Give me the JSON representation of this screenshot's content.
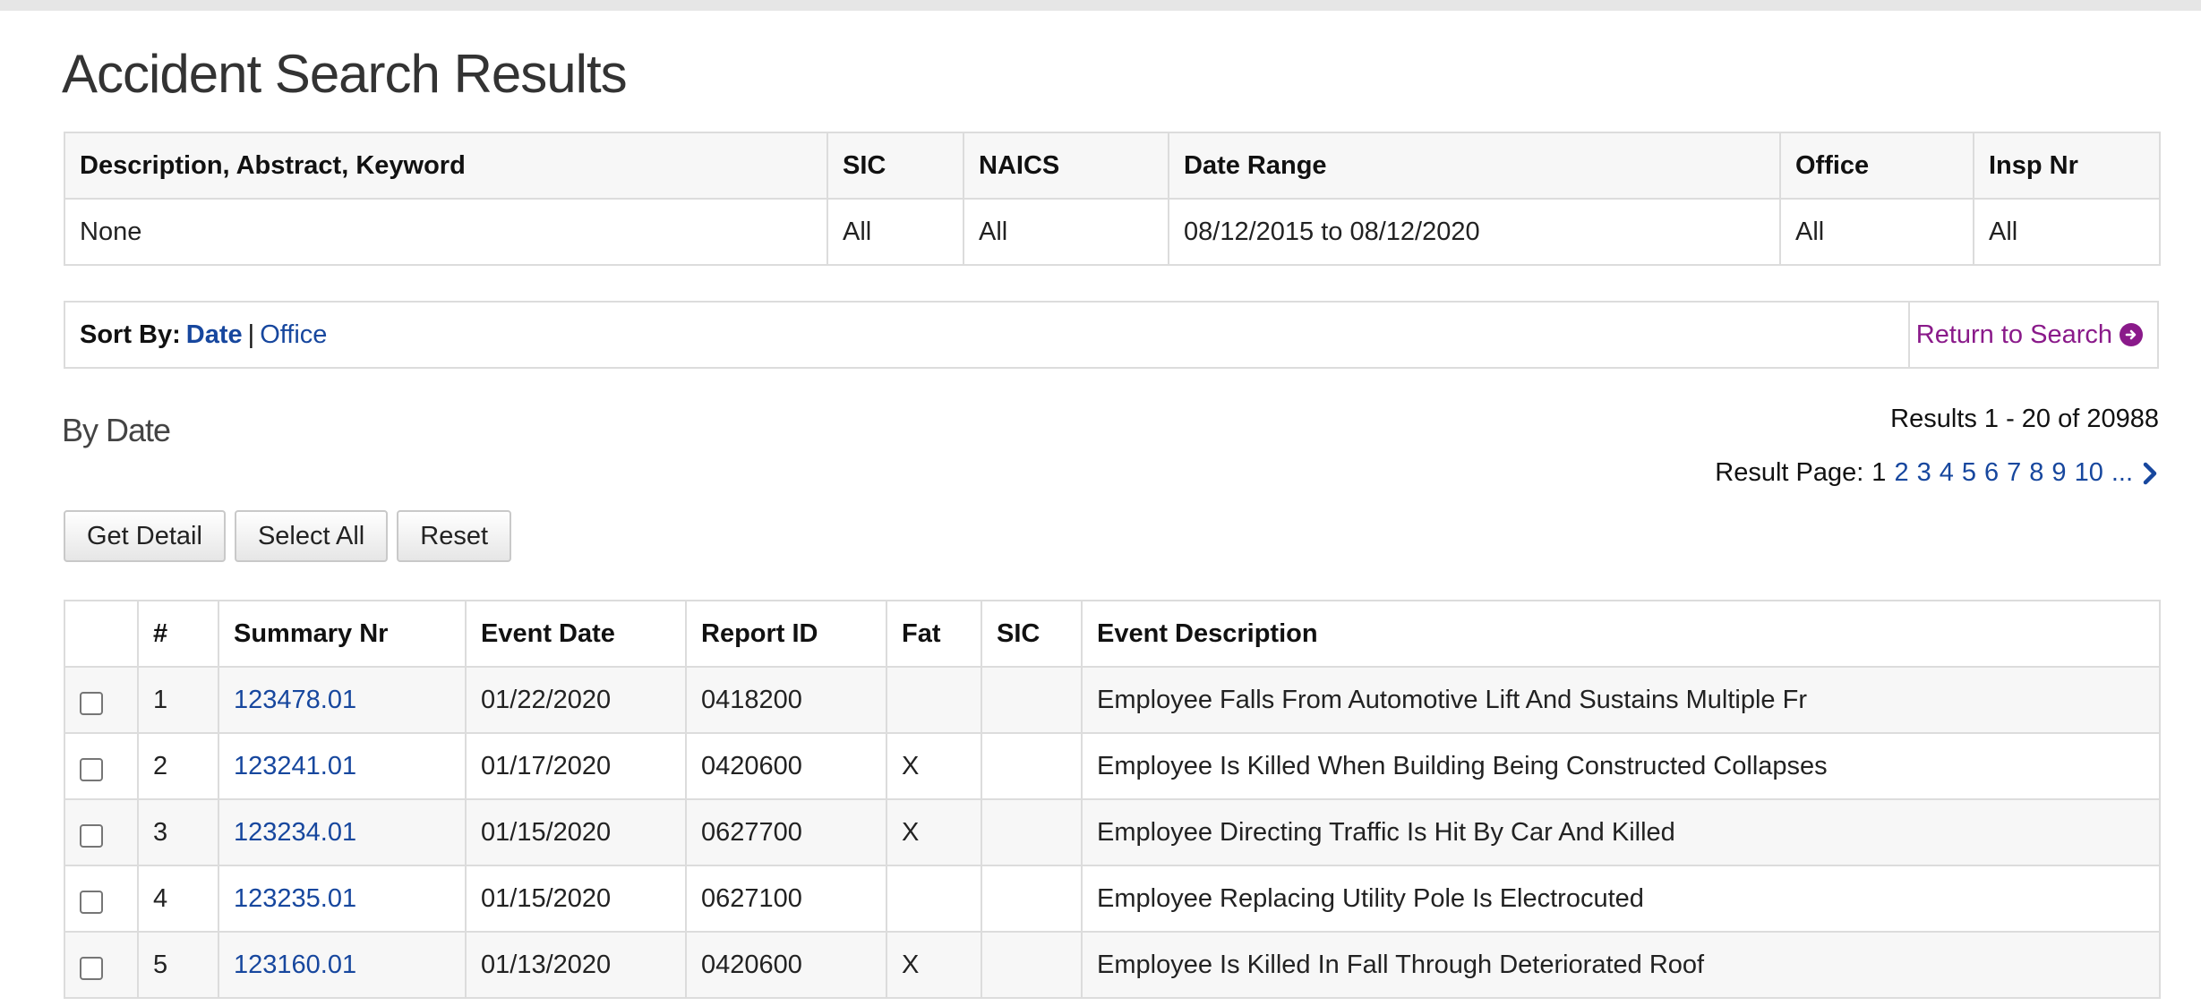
{
  "page": {
    "title": "Accident Search Results"
  },
  "criteria": {
    "headers": [
      "Description, Abstract, Keyword",
      "SIC",
      "NAICS",
      "Date Range",
      "Office",
      "Insp Nr"
    ],
    "values": [
      "None",
      "All",
      "All",
      "08/12/2015 to 08/12/2020",
      "All",
      "All"
    ]
  },
  "sort": {
    "label": "Sort By:",
    "date": "Date",
    "separator": "|",
    "office": "Office",
    "return_label": "Return to Search"
  },
  "results_info": {
    "section_title": "By Date",
    "count_text": "Results 1 - 20 of 20988",
    "pager_label": "Result Page:",
    "current_page": "1",
    "pages": [
      "2",
      "3",
      "4",
      "5",
      "6",
      "7",
      "8",
      "9",
      "10"
    ],
    "ellipsis": "..."
  },
  "buttons": {
    "get_detail": "Get Detail",
    "select_all": "Select All",
    "reset": "Reset"
  },
  "table": {
    "headers": [
      "",
      "#",
      "Summary Nr",
      "Event Date",
      "Report ID",
      "Fat",
      "SIC",
      "Event Description"
    ],
    "rows": [
      {
        "num": "1",
        "summary": "123478.01",
        "date": "01/22/2020",
        "report": "0418200",
        "fat": "",
        "sic": "",
        "desc": "Employee Falls From Automotive Lift And Sustains Multiple Fr"
      },
      {
        "num": "2",
        "summary": "123241.01",
        "date": "01/17/2020",
        "report": "0420600",
        "fat": "X",
        "sic": "",
        "desc": "Employee Is Killed When Building Being Constructed Collapses"
      },
      {
        "num": "3",
        "summary": "123234.01",
        "date": "01/15/2020",
        "report": "0627700",
        "fat": "X",
        "sic": "",
        "desc": "Employee Directing Traffic Is Hit By Car And Killed"
      },
      {
        "num": "4",
        "summary": "123235.01",
        "date": "01/15/2020",
        "report": "0627100",
        "fat": "",
        "sic": "",
        "desc": "Employee Replacing Utility Pole Is Electrocuted"
      },
      {
        "num": "5",
        "summary": "123160.01",
        "date": "01/13/2020",
        "report": "0420600",
        "fat": "X",
        "sic": "",
        "desc": "Employee Is Killed In Fall Through Deteriorated Roof"
      }
    ]
  },
  "colors": {
    "link": "#17479e",
    "return_link": "#8a1a8a",
    "border": "#dcdcdc",
    "stripe": "#f7f7f7"
  },
  "icons": {
    "return": "circle-arrow-right-icon",
    "next_page": "chevron-right-icon"
  }
}
